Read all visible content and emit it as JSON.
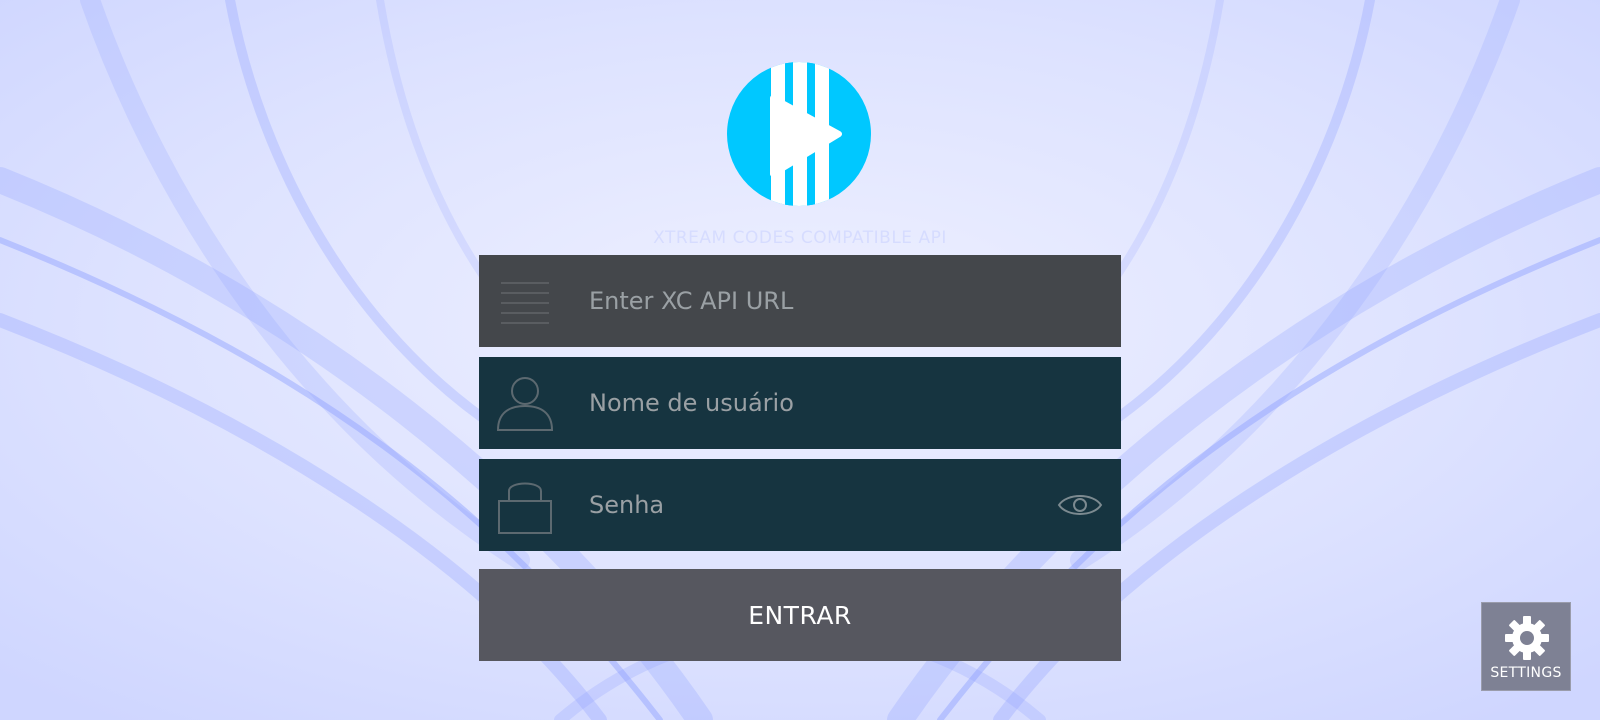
{
  "app": {
    "subtitle": "XTREAM CODES COMPATIBLE API"
  },
  "form": {
    "url_placeholder": "Enter XC API URL",
    "username_placeholder": "Nome de usuário",
    "password_placeholder": "Senha",
    "submit_label": "ENTRAR"
  },
  "settings": {
    "label": "SETTINGS"
  },
  "icons": {
    "logo": "play-logo-icon",
    "url": "list-icon",
    "user": "user-icon",
    "password": "lock-icon",
    "show_password": "eye-icon",
    "settings": "gear-icon"
  },
  "colors": {
    "accent": "#00c8ff",
    "url_field": "#44474b",
    "input_field": "#163440",
    "button": "#56575f",
    "settings_button": "#7e8194"
  }
}
